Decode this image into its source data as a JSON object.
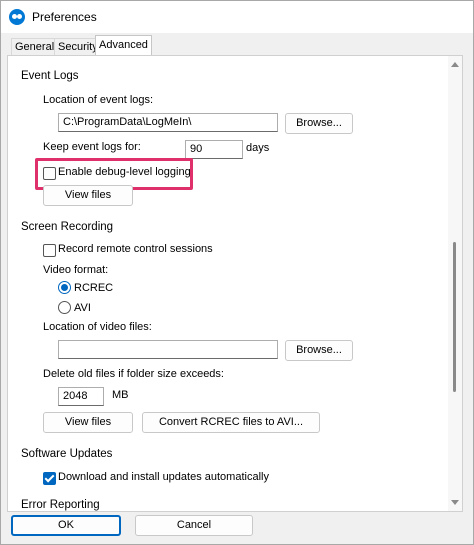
{
  "window": {
    "title": "Preferences"
  },
  "tabs": [
    {
      "label": "General"
    },
    {
      "label": "Security"
    },
    {
      "label": "Advanced",
      "active": true
    }
  ],
  "event_logs": {
    "heading": "Event Logs",
    "location_label": "Location of event logs:",
    "location_value": "C:\\ProgramData\\LogMeIn\\",
    "browse_label": "Browse...",
    "keep_label": "Keep event logs for:",
    "keep_value": "90",
    "keep_unit": "days",
    "debug_label": "Enable debug-level logging",
    "debug_checked": false,
    "view_files_label": "View files"
  },
  "screen_recording": {
    "heading": "Screen Recording",
    "record_label": "Record remote control sessions",
    "record_checked": false,
    "format_label": "Video format:",
    "format_options": [
      {
        "label": "RCREC",
        "selected": true
      },
      {
        "label": "AVI",
        "selected": false
      }
    ],
    "location_label": "Location of video files:",
    "location_value": "",
    "browse_label": "Browse...",
    "delete_label": "Delete old files if folder size exceeds:",
    "size_value": "2048",
    "size_unit": "MB",
    "view_files_label": "View files",
    "convert_label": "Convert RCREC files to AVI..."
  },
  "software_updates": {
    "heading": "Software Updates",
    "auto_label": "Download and install updates automatically",
    "auto_checked": true
  },
  "error_reporting": {
    "heading": "Error Reporting"
  },
  "footer": {
    "ok_label": "OK",
    "cancel_label": "Cancel"
  },
  "colors": {
    "accent": "#0067c0",
    "highlight": "#e0306c"
  }
}
